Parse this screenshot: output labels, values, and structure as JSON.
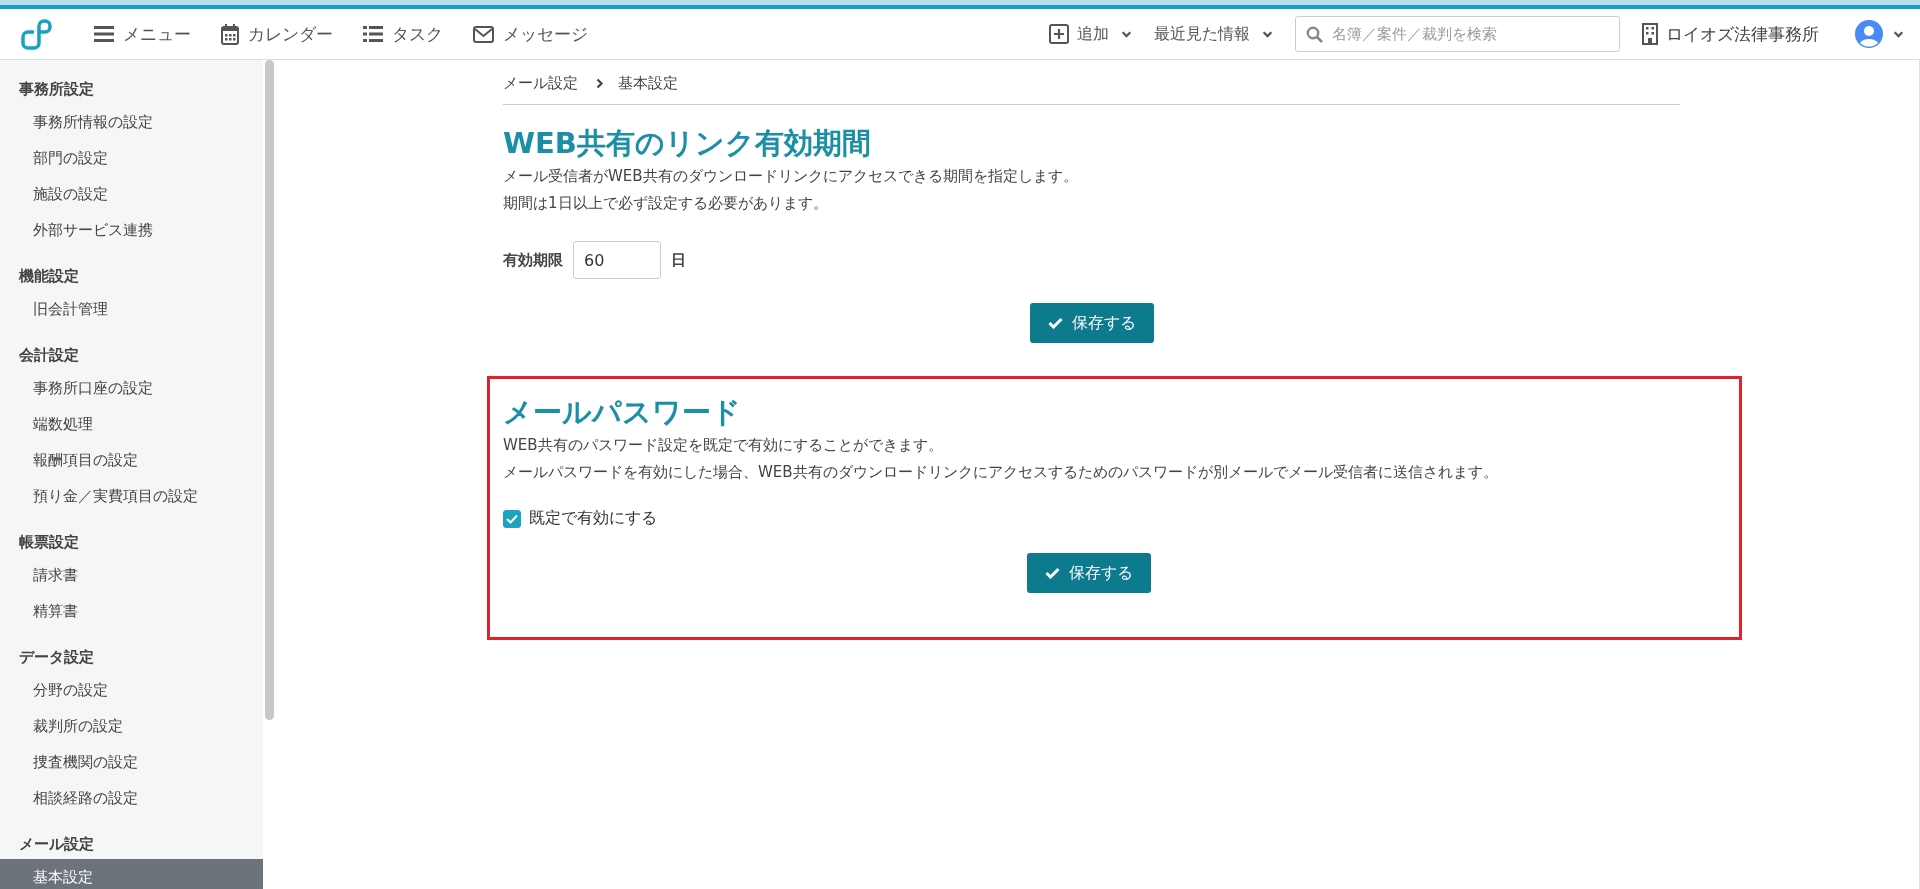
{
  "header": {
    "nav": [
      {
        "kind": "menu",
        "label": "メニュー"
      },
      {
        "kind": "calendar",
        "label": "カレンダー"
      },
      {
        "kind": "task",
        "label": "タスク"
      },
      {
        "kind": "message",
        "label": "メッセージ"
      }
    ],
    "add": {
      "label": "追加"
    },
    "recent": {
      "label": "最近見た情報"
    },
    "search": {
      "placeholder": "名簿／案件／裁判を検索"
    },
    "office": {
      "label": "ロイオズ法律事務所"
    }
  },
  "sidebar": {
    "groups": [
      {
        "title": "事務所設定",
        "items": [
          {
            "label": "事務所情報の設定",
            "selected": false
          },
          {
            "label": "部門の設定",
            "selected": false
          },
          {
            "label": "施設の設定",
            "selected": false
          },
          {
            "label": "外部サービス連携",
            "selected": false
          }
        ]
      },
      {
        "title": "機能設定",
        "items": [
          {
            "label": "旧会計管理",
            "selected": false
          }
        ]
      },
      {
        "title": "会計設定",
        "items": [
          {
            "label": "事務所口座の設定",
            "selected": false
          },
          {
            "label": "端数処理",
            "selected": false
          },
          {
            "label": "報酬項目の設定",
            "selected": false
          },
          {
            "label": "預り金／実費項目の設定",
            "selected": false
          }
        ]
      },
      {
        "title": "帳票設定",
        "items": [
          {
            "label": "請求書",
            "selected": false
          },
          {
            "label": "精算書",
            "selected": false
          }
        ]
      },
      {
        "title": "データ設定",
        "items": [
          {
            "label": "分野の設定",
            "selected": false
          },
          {
            "label": "裁判所の設定",
            "selected": false
          },
          {
            "label": "捜査機関の設定",
            "selected": false
          },
          {
            "label": "相談経路の設定",
            "selected": false
          }
        ]
      },
      {
        "title": "メール設定",
        "items": [
          {
            "label": "基本設定",
            "selected": true
          }
        ]
      }
    ]
  },
  "breadcrumb": [
    "メール設定",
    "基本設定"
  ],
  "sections": [
    {
      "title": "WEB共有のリンク有効期間",
      "highlighted": false,
      "description": [
        "メール受信者がWEB共有のダウンロードリンクにアクセスできる期間を指定します。",
        "期間は1日以上で必ず設定する必要があります。"
      ],
      "field": {
        "label": "有効期限",
        "value": "60",
        "unit": "日"
      },
      "button": "保存する"
    },
    {
      "title": "メールパスワード",
      "highlighted": true,
      "description": [
        "WEB共有のパスワード設定を既定で有効にすることができます。",
        "メールパスワードを有効にした場合、WEB共有のダウンロードリンクにアクセスするためのパスワードが別メールでメール受信者に送信されます。"
      ],
      "checkbox": {
        "label": "既定で有効にする",
        "checked": true
      },
      "button": "保存する"
    }
  ]
}
